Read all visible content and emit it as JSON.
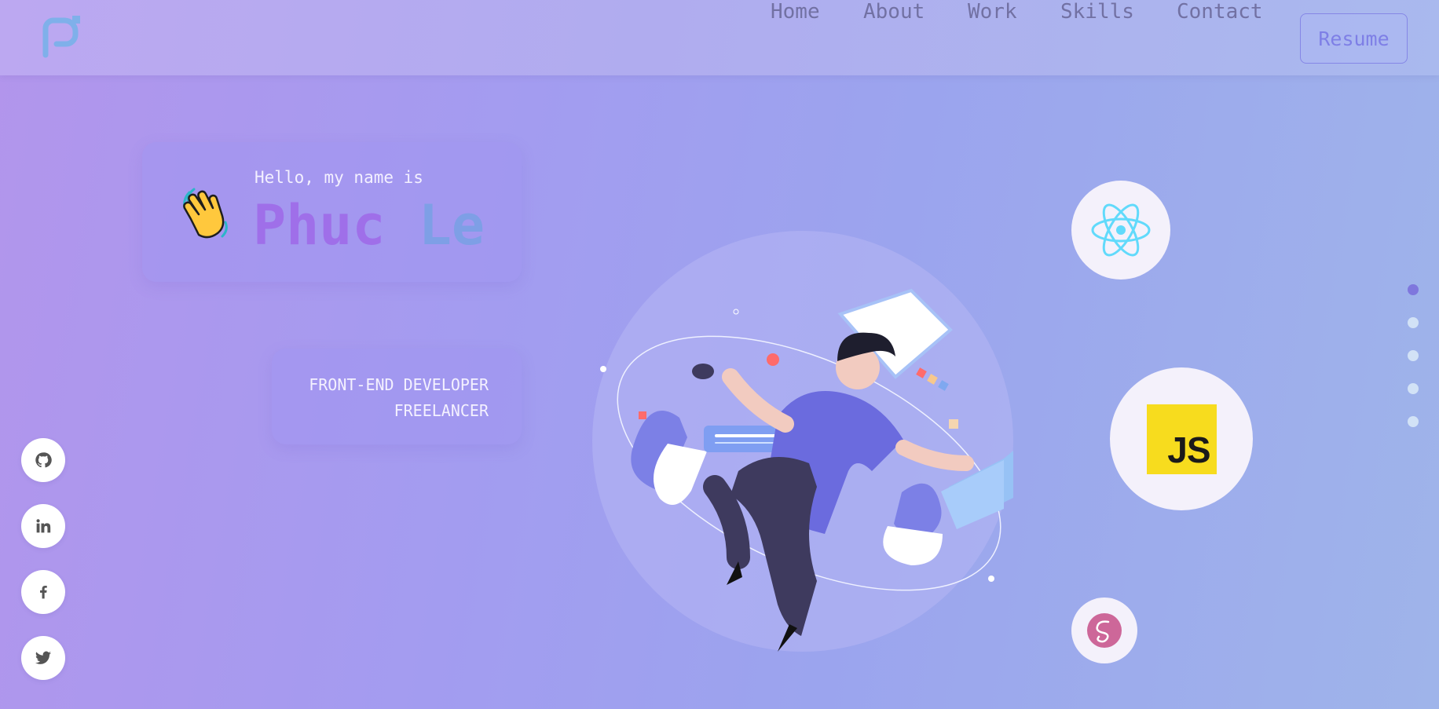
{
  "header": {
    "logo_icon": "logo-icon",
    "nav": [
      {
        "label": "Home"
      },
      {
        "label": "About"
      },
      {
        "label": "Work"
      },
      {
        "label": "Skills"
      },
      {
        "label": "Contact"
      }
    ],
    "resume_label": "Resume"
  },
  "intro": {
    "greeting": "Hello, my name is",
    "first_name": "Phuc",
    "last_name": "Le",
    "wave_icon": "waving-hand-icon",
    "roles": [
      "FRONT-END DEVELOPER",
      "FREELANCER"
    ]
  },
  "social": [
    {
      "icon": "github-icon"
    },
    {
      "icon": "linkedin-icon"
    },
    {
      "icon": "facebook-icon"
    },
    {
      "icon": "twitter-icon"
    }
  ],
  "tech": {
    "react_icon": "react-icon",
    "js_label": "JS",
    "sass_icon": "sass-icon"
  },
  "page_dots": {
    "count": 5,
    "active_index": 0
  },
  "colors": {
    "accent": "#7f77dd",
    "name_first": "#9f6fe9",
    "name_last": "#7e9fe6",
    "js_yellow": "#f7dc1e",
    "react_cyan": "#61dafb",
    "sass_pink": "#cd6799"
  }
}
